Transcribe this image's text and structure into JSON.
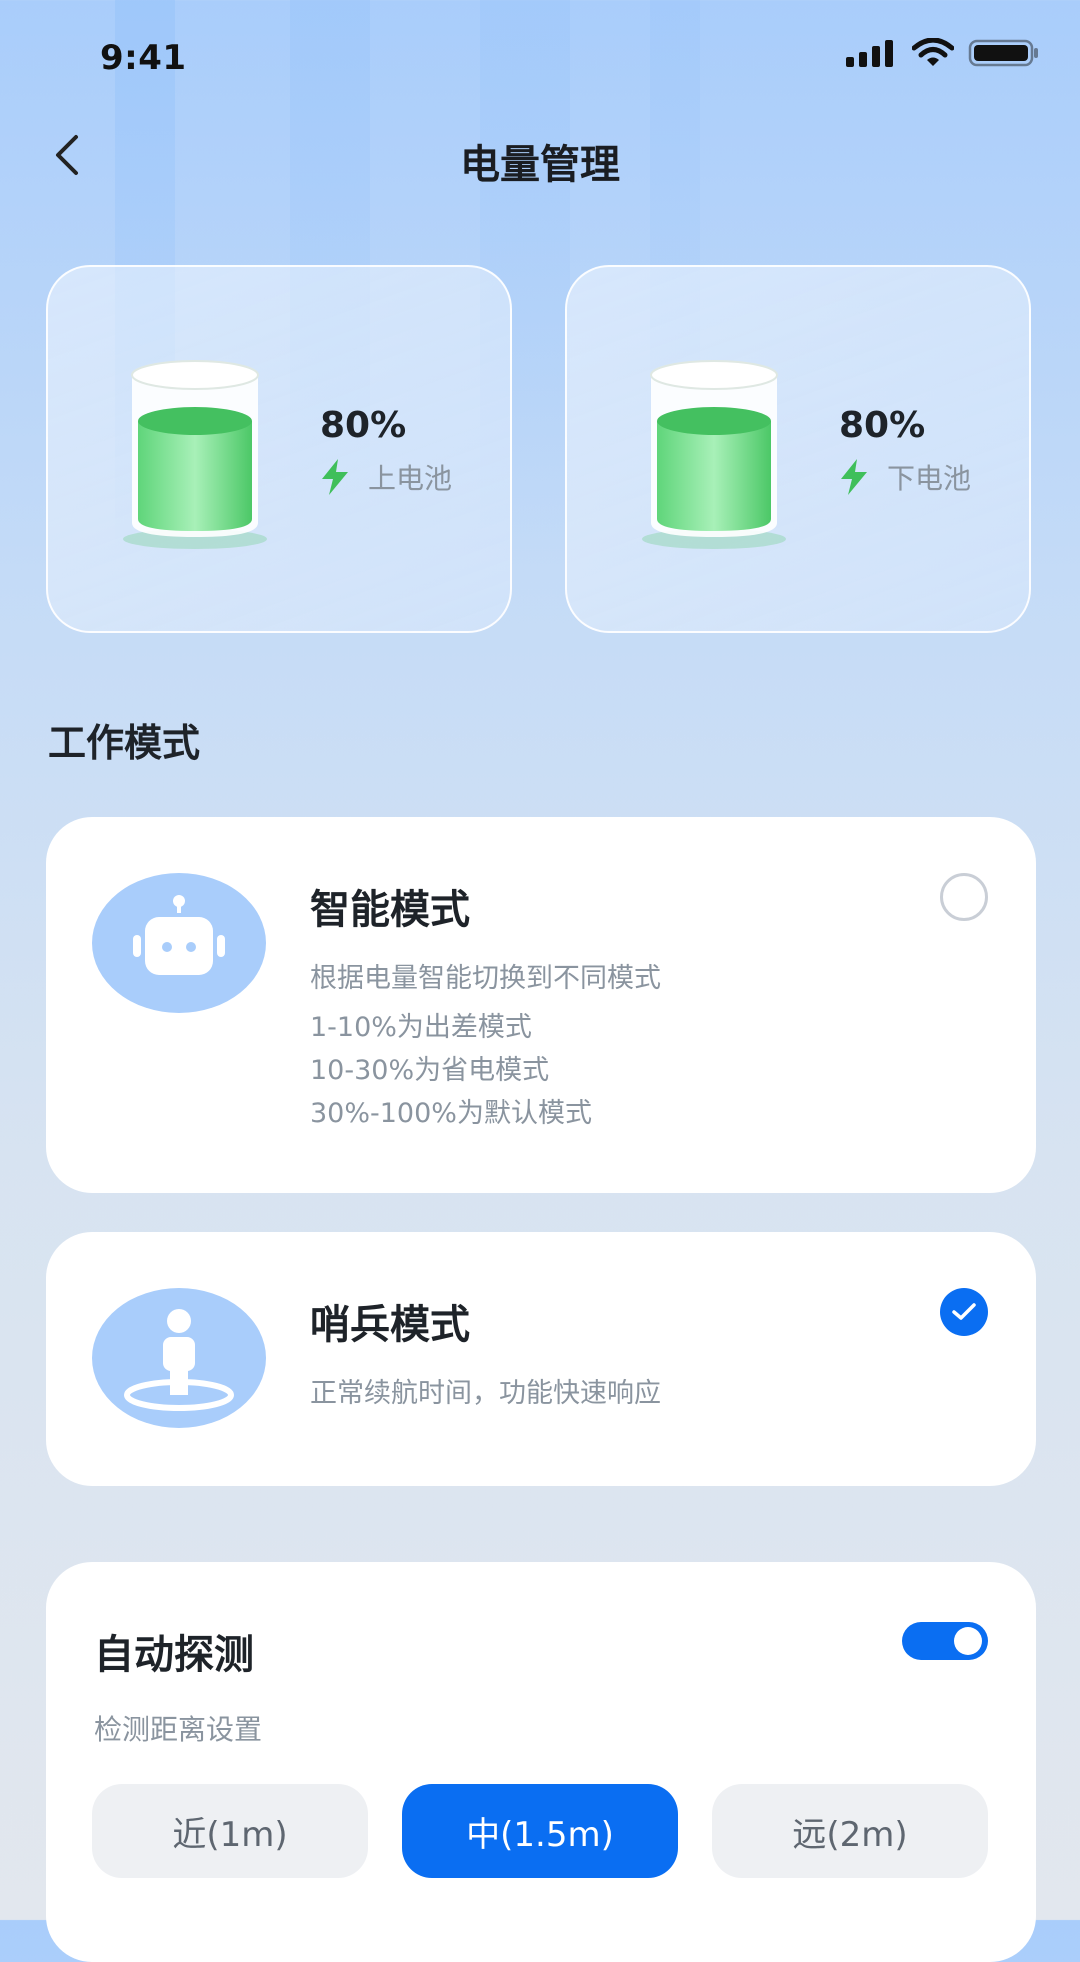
{
  "status_bar": {
    "time": "9:41"
  },
  "header": {
    "title": "电量管理"
  },
  "batteries": [
    {
      "percent": "80%",
      "label": "上电池",
      "level": 0.8
    },
    {
      "percent": "80%",
      "label": "下电池",
      "level": 0.8
    }
  ],
  "work_mode": {
    "section_title": "工作模式",
    "modes": [
      {
        "name": "智能模式",
        "selected": false,
        "description": [
          "根据电量智能切换到不同模式",
          "1-10%为出差模式",
          "10-30%为省电模式",
          "30%-100%为默认模式"
        ]
      },
      {
        "name": "哨兵模式",
        "selected": true,
        "description": [
          "正常续航时间，功能快速响应"
        ]
      }
    ]
  },
  "auto_detect": {
    "title": "自动探测",
    "enabled": true,
    "subtitle": "检测距离设置",
    "options": [
      "近(1m)",
      "中(1.5m)",
      "远(2m)"
    ],
    "selected_option": "中(1.5m)"
  },
  "colors": {
    "accent": "#0a6ef2",
    "battery_green": "#49c864",
    "avatar_bg": "#a9cdfb"
  }
}
